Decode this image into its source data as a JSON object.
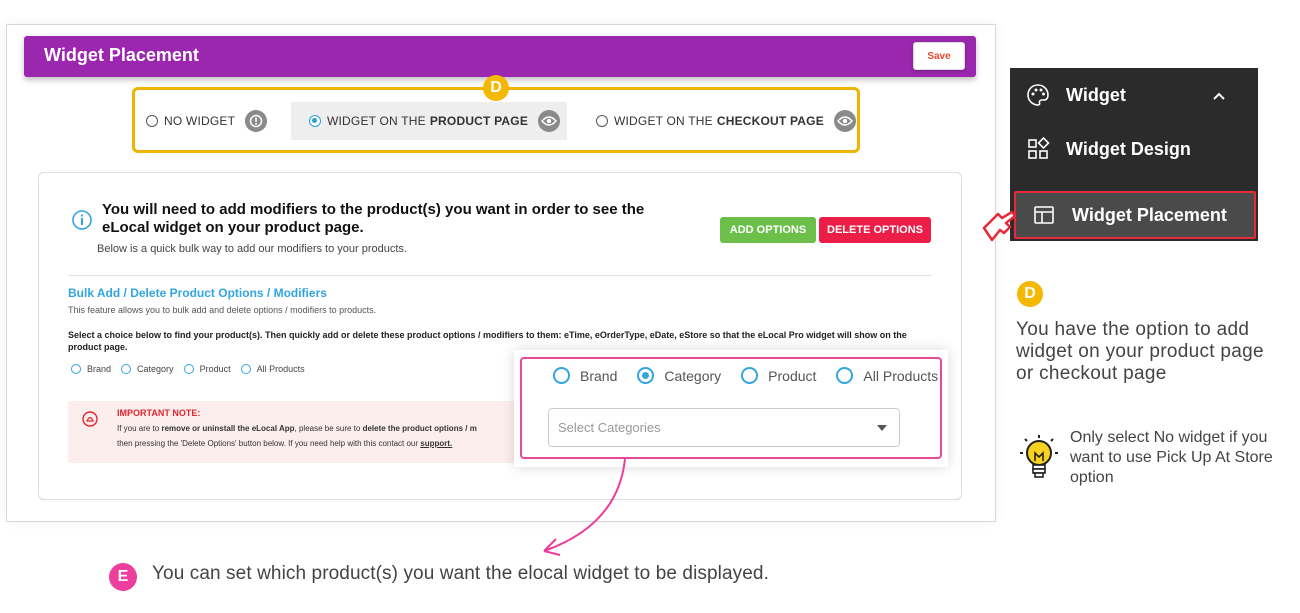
{
  "header": {
    "title": "Widget Placement",
    "save_label": "Save"
  },
  "markers": {
    "d": "D",
    "e": "E"
  },
  "placement_options": [
    {
      "prefix": "NO WIDGET",
      "bold": "",
      "selected": false
    },
    {
      "prefix": "WIDGET ON THE",
      "bold": "PRODUCT PAGE",
      "selected": true
    },
    {
      "prefix": "WIDGET ON THE",
      "bold": "CHECKOUT PAGE",
      "selected": false
    }
  ],
  "info": {
    "title": "You will need to add modifiers to the product(s) you want in order to see the eLocal widget on your product page.",
    "subtitle": "Below is a quick bulk way to add our modifiers to your products."
  },
  "buttons": {
    "add_options": "ADD OPTIONS",
    "delete_options": "DELETE OPTIONS"
  },
  "bulk": {
    "title": "Bulk Add / Delete Product Options / Modifiers",
    "description": "This feature allows you to bulk add and delete options / modifiers to products.",
    "choice_text": "Select a choice below to find your product(s). Then quickly add or delete these product options / modifiers to them: eTime, eOrderType, eDate, eStore so that the eLocal Pro widget will show on the product page.",
    "radios": [
      "Brand",
      "Category",
      "Product",
      "All Products"
    ]
  },
  "note": {
    "title": "IMPORTANT NOTE:",
    "line1_a": "If you are to ",
    "line1_b": "remove or uninstall the eLocal App",
    "line1_c": ", please be sure to ",
    "line1_d": "delete the product options / m",
    "line2_a": "then pressing the 'Delete Options' button below. If you need help with this contact our ",
    "line2_b": "support."
  },
  "zoom": {
    "radios": [
      {
        "label": "Brand",
        "selected": false
      },
      {
        "label": "Category",
        "selected": true
      },
      {
        "label": "Product",
        "selected": false
      },
      {
        "label": "All Products",
        "selected": false
      }
    ],
    "select_placeholder": "Select Categories"
  },
  "menu": {
    "items": [
      {
        "label": "Widget",
        "icon": "palette-icon"
      },
      {
        "label": "Widget Design",
        "icon": "widgets-icon"
      },
      {
        "label": "Widget Placement",
        "icon": "placement-icon"
      }
    ]
  },
  "annotations": {
    "e_text": "You can set which product(s) you want the elocal widget to be displayed.",
    "d_text": "You have the option to add widget on your product page or checkout page",
    "tip_text": "Only select No widget if you want to use Pick Up At Store option"
  },
  "colors": {
    "header_purple": "#9b27af",
    "highlight_yellow": "#f0b400",
    "highlight_pink": "#e8479e",
    "add_green": "#6cc04a",
    "delete_red": "#ec1e48",
    "link_blue": "#33a5e0"
  }
}
